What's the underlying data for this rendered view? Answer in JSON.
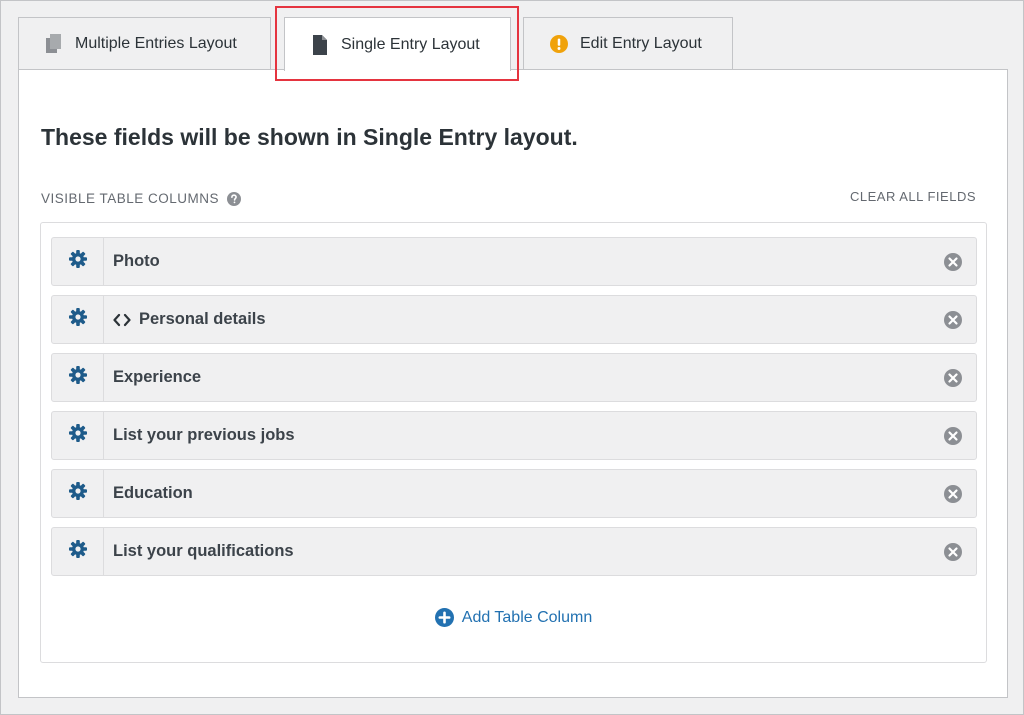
{
  "tabs": [
    {
      "label": "Multiple Entries Layout",
      "icon": "copy-icon"
    },
    {
      "label": "Single Entry Layout",
      "icon": "document-icon",
      "active": true
    },
    {
      "label": "Edit Entry Layout",
      "icon": "warning-icon"
    }
  ],
  "panel": {
    "heading": "These fields will be shown in Single Entry layout.",
    "section_label": "VISIBLE TABLE COLUMNS",
    "clear_all": "CLEAR ALL FIELDS",
    "fields": [
      {
        "label": "Photo"
      },
      {
        "label": "Personal details",
        "icon": "code-icon"
      },
      {
        "label": "Experience"
      },
      {
        "label": "List your previous jobs"
      },
      {
        "label": "Education"
      },
      {
        "label": "List your qualifications"
      }
    ],
    "add_column": "Add Table Column"
  },
  "colors": {
    "accent": "#2271b1",
    "warning": "#f0a20b",
    "highlight": "#e5343f",
    "gear": "#1e5b8a"
  }
}
